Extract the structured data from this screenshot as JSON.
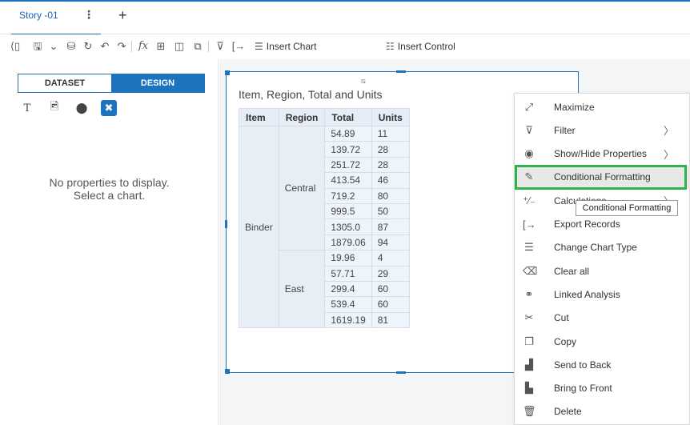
{
  "tabbar": {
    "tab_label": "Story -01",
    "more_glyph": "⋮",
    "add_glyph": "+"
  },
  "toolbar": {
    "insert_chart_label": "Insert Chart",
    "insert_control_label": "Insert Control"
  },
  "left_panel": {
    "segments": [
      "DATASET",
      "DESIGN"
    ],
    "active_segment": "DESIGN",
    "message_line1": "No properties to display.",
    "message_line2": "Select a chart."
  },
  "widget": {
    "title": "Item, Region, Total and Units",
    "columns": [
      "Item",
      "Region",
      "Total",
      "Units"
    ],
    "item": "Binder",
    "groups": [
      {
        "region": "Central",
        "rows": [
          [
            "54.89",
            "11"
          ],
          [
            "139.72",
            "28"
          ],
          [
            "251.72",
            "28"
          ],
          [
            "413.54",
            "46"
          ],
          [
            "719.2",
            "80"
          ],
          [
            "999.5",
            "50"
          ],
          [
            "1305.0",
            "87"
          ],
          [
            "1879.06",
            "94"
          ]
        ]
      },
      {
        "region": "East",
        "rows": [
          [
            "19.96",
            "4"
          ],
          [
            "57.71",
            "29"
          ],
          [
            "299.4",
            "60"
          ],
          [
            "539.4",
            "60"
          ],
          [
            "1619.19",
            "81"
          ]
        ]
      }
    ]
  },
  "context_menu": {
    "items": [
      {
        "label": "Maximize",
        "icon": "maximize-icon",
        "submenu": false
      },
      {
        "label": "Filter",
        "icon": "filter-icon",
        "submenu": true
      },
      {
        "label": "Show/Hide Properties",
        "icon": "eye-icon",
        "submenu": true
      },
      {
        "label": "Conditional Formatting",
        "icon": "edit-icon",
        "submenu": false,
        "highlighted": true
      },
      {
        "label": "Calculations",
        "icon": "calculator-icon",
        "submenu": true
      },
      {
        "label": "Export Records",
        "icon": "export-icon",
        "submenu": false
      },
      {
        "label": "Change Chart Type",
        "icon": "chart-type-icon",
        "submenu": false
      },
      {
        "label": "Clear all",
        "icon": "eraser-icon",
        "submenu": false
      },
      {
        "label": "Linked Analysis",
        "icon": "link-icon",
        "submenu": false
      },
      {
        "label": "Cut",
        "icon": "scissors-icon",
        "submenu": false
      },
      {
        "label": "Copy",
        "icon": "copy-icon",
        "submenu": false
      },
      {
        "label": "Send to Back",
        "icon": "send-to-back-icon",
        "submenu": false
      },
      {
        "label": "Bring to Front",
        "icon": "bring-to-front-icon",
        "submenu": false
      },
      {
        "label": "Delete",
        "icon": "trash-icon",
        "submenu": false
      }
    ],
    "tooltip": "Conditional Formatting"
  },
  "colors": {
    "accent": "#1e73be",
    "highlight_box": "#2db34a"
  }
}
